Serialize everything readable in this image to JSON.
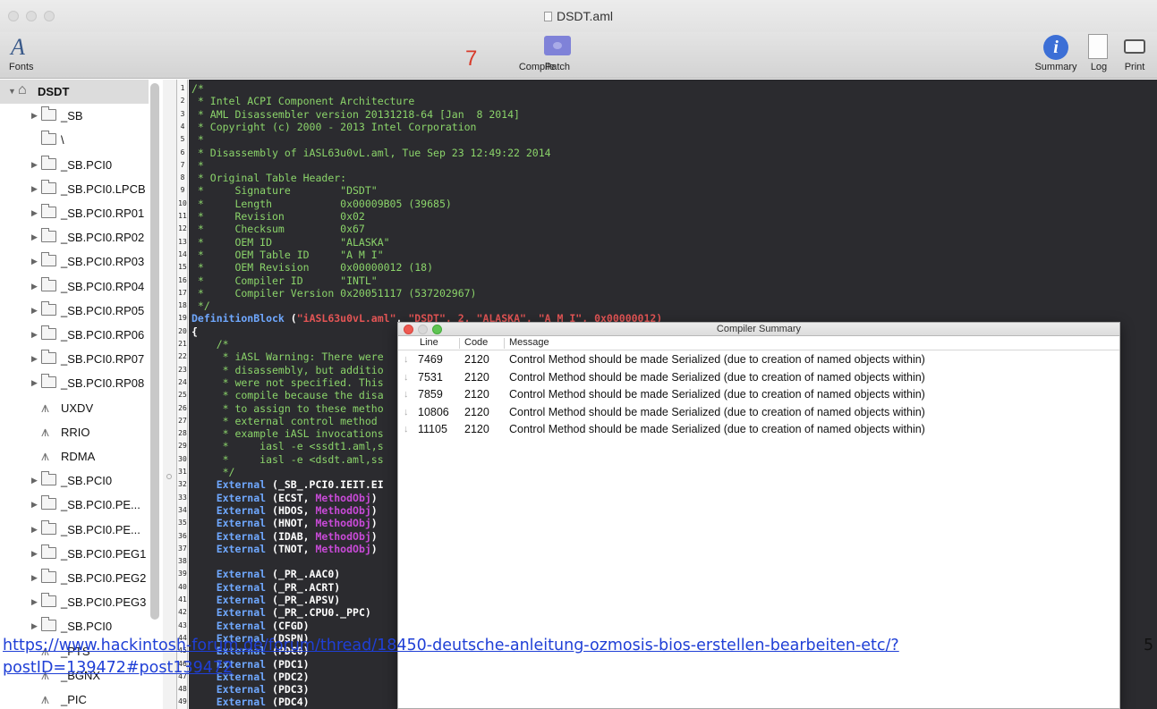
{
  "window": {
    "title": "DSDT.aml"
  },
  "toolbar": {
    "fonts_label": "Fonts",
    "fonts_glyph": "A",
    "annotation_number": "7",
    "compile_label": "Compile",
    "patch_label": "Patch",
    "summary_label": "Summary",
    "summary_glyph": "i",
    "log_label": "Log",
    "print_label": "Print"
  },
  "sidebar": {
    "items": [
      {
        "label": "DSDT",
        "icon": "home-icon",
        "expander": "open"
      },
      {
        "label": "_SB",
        "icon": "folder-icon",
        "expander": "closed"
      },
      {
        "label": "\\",
        "icon": "folder-icon",
        "expander": "none"
      },
      {
        "label": "_SB.PCI0",
        "icon": "folder-icon",
        "expander": "closed"
      },
      {
        "label": "_SB.PCI0.LPCB",
        "icon": "folder-icon",
        "expander": "closed"
      },
      {
        "label": "_SB.PCI0.RP01",
        "icon": "folder-icon",
        "expander": "closed"
      },
      {
        "label": "_SB.PCI0.RP02",
        "icon": "folder-icon",
        "expander": "closed"
      },
      {
        "label": "_SB.PCI0.RP03",
        "icon": "folder-icon",
        "expander": "closed"
      },
      {
        "label": "_SB.PCI0.RP04",
        "icon": "folder-icon",
        "expander": "closed"
      },
      {
        "label": "_SB.PCI0.RP05",
        "icon": "folder-icon",
        "expander": "closed"
      },
      {
        "label": "_SB.PCI0.RP06",
        "icon": "folder-icon",
        "expander": "closed"
      },
      {
        "label": "_SB.PCI0.RP07",
        "icon": "folder-icon",
        "expander": "closed"
      },
      {
        "label": "_SB.PCI0.RP08",
        "icon": "folder-icon",
        "expander": "closed"
      },
      {
        "label": "UXDV",
        "icon": "method-icon",
        "expander": "none"
      },
      {
        "label": "RRIO",
        "icon": "method-icon",
        "expander": "none"
      },
      {
        "label": "RDMA",
        "icon": "method-icon",
        "expander": "none"
      },
      {
        "label": "_SB.PCI0",
        "icon": "folder-icon",
        "expander": "closed"
      },
      {
        "label": "_SB.PCI0.PE...",
        "icon": "folder-icon",
        "expander": "closed"
      },
      {
        "label": "_SB.PCI0.PE...",
        "icon": "folder-icon",
        "expander": "closed"
      },
      {
        "label": "_SB.PCI0.PEG1",
        "icon": "folder-icon",
        "expander": "closed"
      },
      {
        "label": "_SB.PCI0.PEG2",
        "icon": "folder-icon",
        "expander": "closed"
      },
      {
        "label": "_SB.PCI0.PEG3",
        "icon": "folder-icon",
        "expander": "closed"
      },
      {
        "label": "_SB.PCI0",
        "icon": "folder-icon",
        "expander": "closed"
      },
      {
        "label": "_PTS",
        "icon": "method-icon",
        "expander": "none"
      },
      {
        "label": "_BGNX",
        "icon": "method-icon",
        "expander": "none"
      },
      {
        "label": "_PIC",
        "icon": "method-icon",
        "expander": "none"
      }
    ]
  },
  "editor": {
    "lines": [
      {
        "n": "1",
        "t": "/*",
        "k": "comment"
      },
      {
        "n": "2",
        "t": " * Intel ACPI Component Architecture",
        "k": "comment"
      },
      {
        "n": "3",
        "t": " * AML Disassembler version 20131218-64 [Jan  8 2014]",
        "k": "comment"
      },
      {
        "n": "4",
        "t": " * Copyright (c) 2000 - 2013 Intel Corporation",
        "k": "comment"
      },
      {
        "n": "5",
        "t": " *",
        "k": "comment"
      },
      {
        "n": "6",
        "t": " * Disassembly of iASL63u0vL.aml, Tue Sep 23 12:49:22 2014",
        "k": "comment"
      },
      {
        "n": "7",
        "t": " *",
        "k": "comment"
      },
      {
        "n": "8",
        "t": " * Original Table Header:",
        "k": "comment"
      },
      {
        "n": "9",
        "t": " *     Signature        \"DSDT\"",
        "k": "comment"
      },
      {
        "n": "10",
        "t": " *     Length           0x00009B05 (39685)",
        "k": "comment"
      },
      {
        "n": "11",
        "t": " *     Revision         0x02",
        "k": "comment"
      },
      {
        "n": "12",
        "t": " *     Checksum         0x67",
        "k": "comment"
      },
      {
        "n": "13",
        "t": " *     OEM ID           \"ALASKA\"",
        "k": "comment"
      },
      {
        "n": "14",
        "t": " *     OEM Table ID     \"A M I\"",
        "k": "comment"
      },
      {
        "n": "15",
        "t": " *     OEM Revision     0x00000012 (18)",
        "k": "comment"
      },
      {
        "n": "16",
        "t": " *     Compiler ID      \"INTL\"",
        "k": "comment"
      },
      {
        "n": "17",
        "t": " *     Compiler Version 0x20051117 (537202967)",
        "k": "comment"
      },
      {
        "n": "18",
        "t": " */",
        "k": "comment"
      },
      {
        "n": "19",
        "t": "",
        "k": "defblock",
        "a": "DefinitionBlock",
        "b": " (",
        "c": "\"iASL63u0vL.aml\"",
        "d": ", ",
        "e": "\"DSDT\"",
        "f": ", 2, \"ALASKA\", \"A M I\", 0x00000012)"
      },
      {
        "n": "20",
        "t": "{",
        "k": "code"
      },
      {
        "n": "21",
        "t": "    /*",
        "k": "comment"
      },
      {
        "n": "22",
        "t": "     * iASL Warning: There were",
        "k": "comment"
      },
      {
        "n": "23",
        "t": "     * disassembly, but additio",
        "k": "comment"
      },
      {
        "n": "24",
        "t": "     * were not specified. This",
        "k": "comment"
      },
      {
        "n": "25",
        "t": "     * compile because the disa",
        "k": "comment"
      },
      {
        "n": "26",
        "t": "     * to assign to these metho",
        "k": "comment"
      },
      {
        "n": "27",
        "t": "     * external control method",
        "k": "comment"
      },
      {
        "n": "28",
        "t": "     * example iASL invocations",
        "k": "comment"
      },
      {
        "n": "29",
        "t": "     *     iasl -e <ssdt1.aml,s",
        "k": "comment"
      },
      {
        "n": "30",
        "t": "     *     iasl -e <dsdt.aml,ss",
        "k": "comment"
      },
      {
        "n": "31",
        "t": "     */",
        "k": "comment"
      },
      {
        "n": "32",
        "t": "",
        "k": "ext",
        "a": "    External",
        "b": " (_SB_.PCI0.IEIT.EI",
        "c": ""
      },
      {
        "n": "33",
        "t": "",
        "k": "ext",
        "a": "    External",
        "b": " (ECST, ",
        "c": "MethodObj",
        "d": ")"
      },
      {
        "n": "34",
        "t": "",
        "k": "ext",
        "a": "    External",
        "b": " (HDOS, ",
        "c": "MethodObj",
        "d": ")"
      },
      {
        "n": "35",
        "t": "",
        "k": "ext",
        "a": "    External",
        "b": " (HNOT, ",
        "c": "MethodObj",
        "d": ")"
      },
      {
        "n": "36",
        "t": "",
        "k": "ext",
        "a": "    External",
        "b": " (IDAB, ",
        "c": "MethodObj",
        "d": ")"
      },
      {
        "n": "37",
        "t": "",
        "k": "ext",
        "a": "    External",
        "b": " (TNOT, ",
        "c": "MethodObj",
        "d": ")"
      },
      {
        "n": "38",
        "t": "",
        "k": "code"
      },
      {
        "n": "39",
        "t": "",
        "k": "ext",
        "a": "    External",
        "b": " (_PR_.AAC0)",
        "c": ""
      },
      {
        "n": "40",
        "t": "",
        "k": "ext",
        "a": "    External",
        "b": " (_PR_.ACRT)",
        "c": ""
      },
      {
        "n": "41",
        "t": "",
        "k": "ext",
        "a": "    External",
        "b": " (_PR_.APSV)",
        "c": ""
      },
      {
        "n": "42",
        "t": "",
        "k": "ext",
        "a": "    External",
        "b": " (_PR_.CPU0._PPC)",
        "c": ""
      },
      {
        "n": "43",
        "t": "",
        "k": "ext",
        "a": "    External",
        "b": " (CFGD)",
        "c": ""
      },
      {
        "n": "44",
        "t": "",
        "k": "ext",
        "a": "    External",
        "b": " (DSPN)",
        "c": ""
      },
      {
        "n": "45",
        "t": "",
        "k": "ext",
        "a": "    External",
        "b": " (PDC0)",
        "c": ""
      },
      {
        "n": "46",
        "t": "",
        "k": "ext",
        "a": "    External",
        "b": " (PDC1)",
        "c": ""
      },
      {
        "n": "47",
        "t": "",
        "k": "ext",
        "a": "    External",
        "b": " (PDC2)",
        "c": ""
      },
      {
        "n": "48",
        "t": "",
        "k": "ext",
        "a": "    External",
        "b": " (PDC3)",
        "c": ""
      },
      {
        "n": "49",
        "t": "",
        "k": "ext",
        "a": "    External",
        "b": " (PDC4)",
        "c": ""
      }
    ]
  },
  "compiler_summary": {
    "title": "Compiler Summary",
    "columns": {
      "line": "Line",
      "code": "Code",
      "message": "Message"
    },
    "rows": [
      {
        "line": "7469",
        "code": "2120",
        "message": "Control Method should be made Serialized (due to creation of named objects within)"
      },
      {
        "line": "7531",
        "code": "2120",
        "message": "Control Method should be made Serialized (due to creation of named objects within)"
      },
      {
        "line": "7859",
        "code": "2120",
        "message": "Control Method should be made Serialized (due to creation of named objects within)"
      },
      {
        "line": "10806",
        "code": "2120",
        "message": "Control Method should be made Serialized (due to creation of named objects within)"
      },
      {
        "line": "11105",
        "code": "2120",
        "message": "Control Method should be made Serialized (due to creation of named objects within)"
      }
    ]
  },
  "footer": {
    "link": "https://www.hackintosh-forum.de/forum/thread/18450-deutsche-anleitung-ozmosis-bios-erstellen-bearbeiten-etc/?postID=139472#post139472",
    "page_number": "5"
  },
  "colors": {
    "code_bg": "#2b2b2f",
    "comment": "#8bd46a",
    "keyword": "#6fa8ff",
    "method": "#c84ad7",
    "annotation": "#d83a2a",
    "link": "#1f3fd6"
  }
}
